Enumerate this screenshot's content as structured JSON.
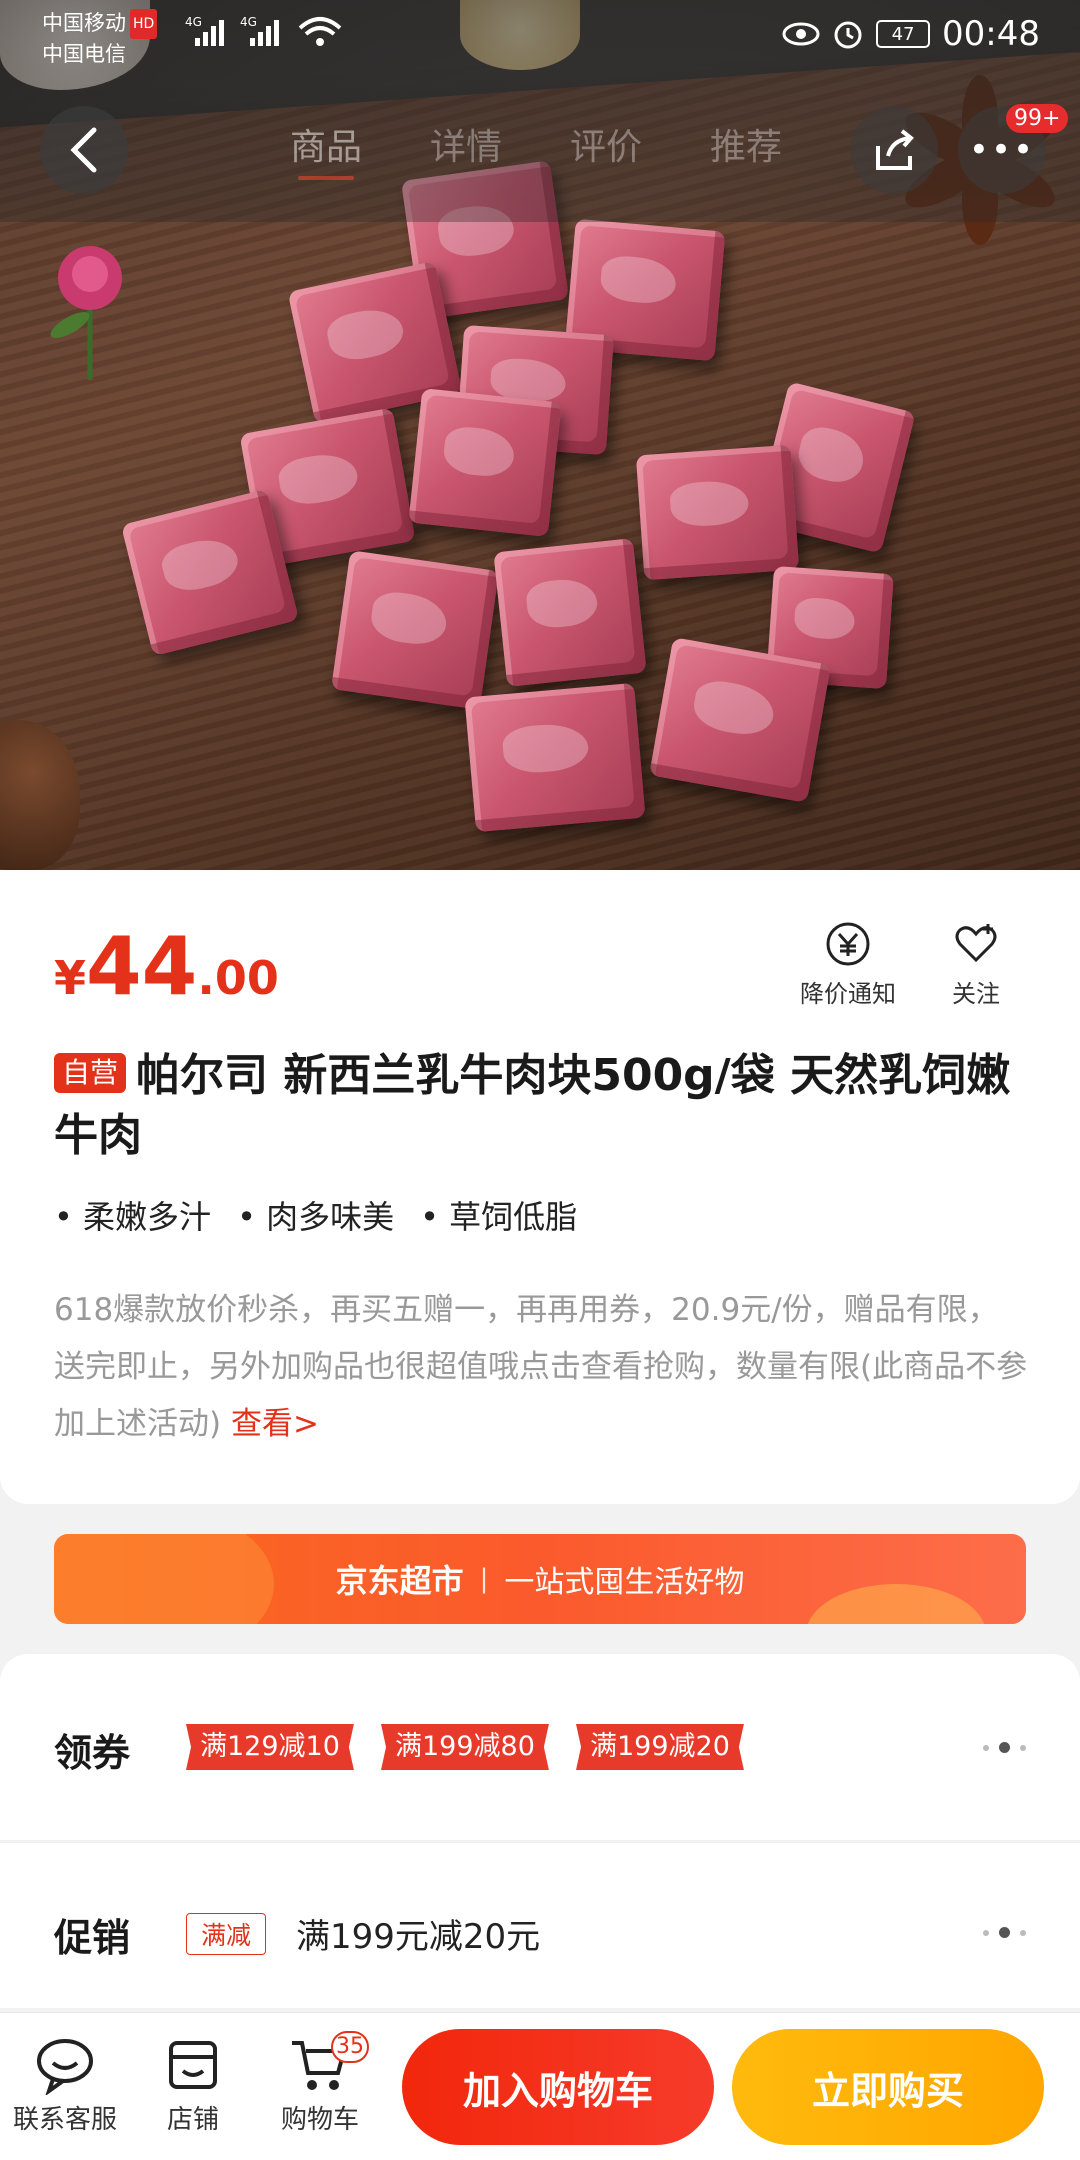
{
  "status_bar": {
    "carrier1": "中国移动",
    "hd": "HD",
    "carrier2": "中国电信",
    "net1": "4G",
    "net2": "4G",
    "battery": "47",
    "time": "00:48"
  },
  "nav": {
    "tabs": [
      {
        "label": "商品",
        "active": true
      },
      {
        "label": "详情",
        "active": false
      },
      {
        "label": "评价",
        "active": false
      },
      {
        "label": "推荐",
        "active": false
      }
    ],
    "more_badge": "99+"
  },
  "product": {
    "price_symbol": "¥",
    "price_int": "44",
    "price_dec": ".00",
    "price_notify_label": "降价通知",
    "follow_label": "关注",
    "self_tag": "自营",
    "title": "帕尔司 新西兰乳牛肉块500g/袋 天然乳饲嫩牛肉",
    "features": [
      "• 柔嫩多汁",
      "• 肉多味美",
      "• 草饲低脂"
    ],
    "description": "618爆款放价秒杀，再买五赠一，再再用券，20.9元/份，赠品有限，送完即止，另外加购品也很超值哦点击查看抢购，数量有限(此商品不参加上述活动) ",
    "desc_link": "查看>"
  },
  "banner": {
    "brand": "京东超市",
    "sep": "|",
    "slogan": "一站式囤生活好物"
  },
  "coupon": {
    "label": "领券",
    "chips": [
      "满129减10",
      "满199减80",
      "满199减20"
    ]
  },
  "promo": {
    "label": "促销",
    "tag": "满减",
    "text": "满199元减20元"
  },
  "bottom_bar": {
    "service_label": "联系客服",
    "shop_label": "店铺",
    "cart_label": "购物车",
    "cart_count": "35",
    "add_cart_button": "加入购物车",
    "buy_now_button": "立即购买"
  },
  "colors": {
    "accent": "#e4321a",
    "buy_yellow": "#ffa600",
    "banner_orange": "#f96a1e"
  },
  "icons": [
    "back-icon",
    "share-icon",
    "more-icon",
    "price-notify-icon",
    "heart-icon",
    "chat-icon",
    "shop-icon",
    "cart-icon"
  ]
}
